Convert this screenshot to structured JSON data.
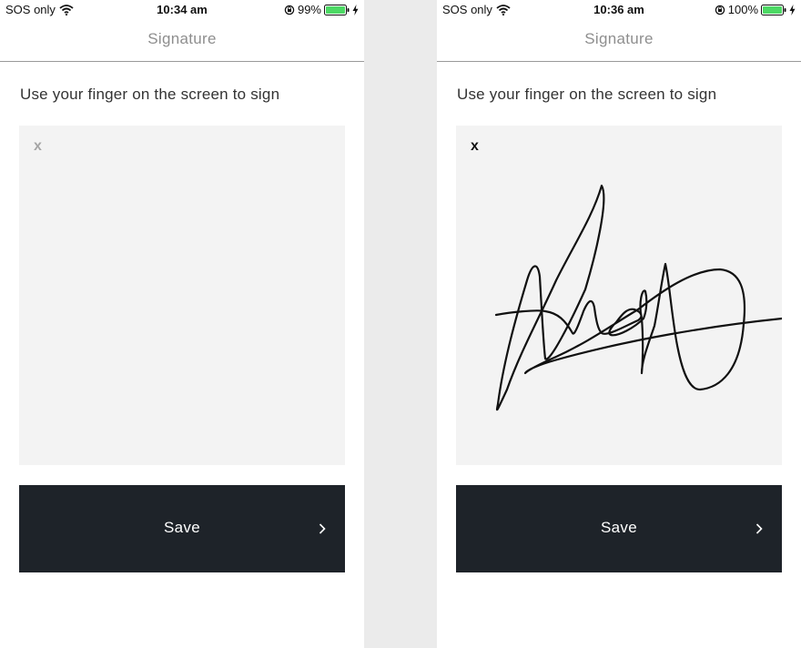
{
  "screens": [
    {
      "status": {
        "carrier": "SOS only",
        "time": "10:34 am",
        "battery": "99%"
      },
      "nav_title": "Signature",
      "instruction": "Use your finger on the screen to sign",
      "signature_marker": "x",
      "signature_present": false,
      "save_label": "Save"
    },
    {
      "status": {
        "carrier": "SOS only",
        "time": "10:36 am",
        "battery": "100%"
      },
      "nav_title": "Signature",
      "instruction": "Use your finger on the screen to sign",
      "signature_marker": "x",
      "signature_present": true,
      "save_label": "Save"
    }
  ],
  "colors": {
    "button_bg": "#1e2329",
    "pad_bg": "#f3f3f3",
    "battery_fill": "#4cd964",
    "divider_bg": "#ebebeb"
  },
  "icons": [
    "wifi-icon",
    "orientation-lock-icon",
    "battery-icon",
    "charging-bolt-icon",
    "chevron-right-icon"
  ]
}
